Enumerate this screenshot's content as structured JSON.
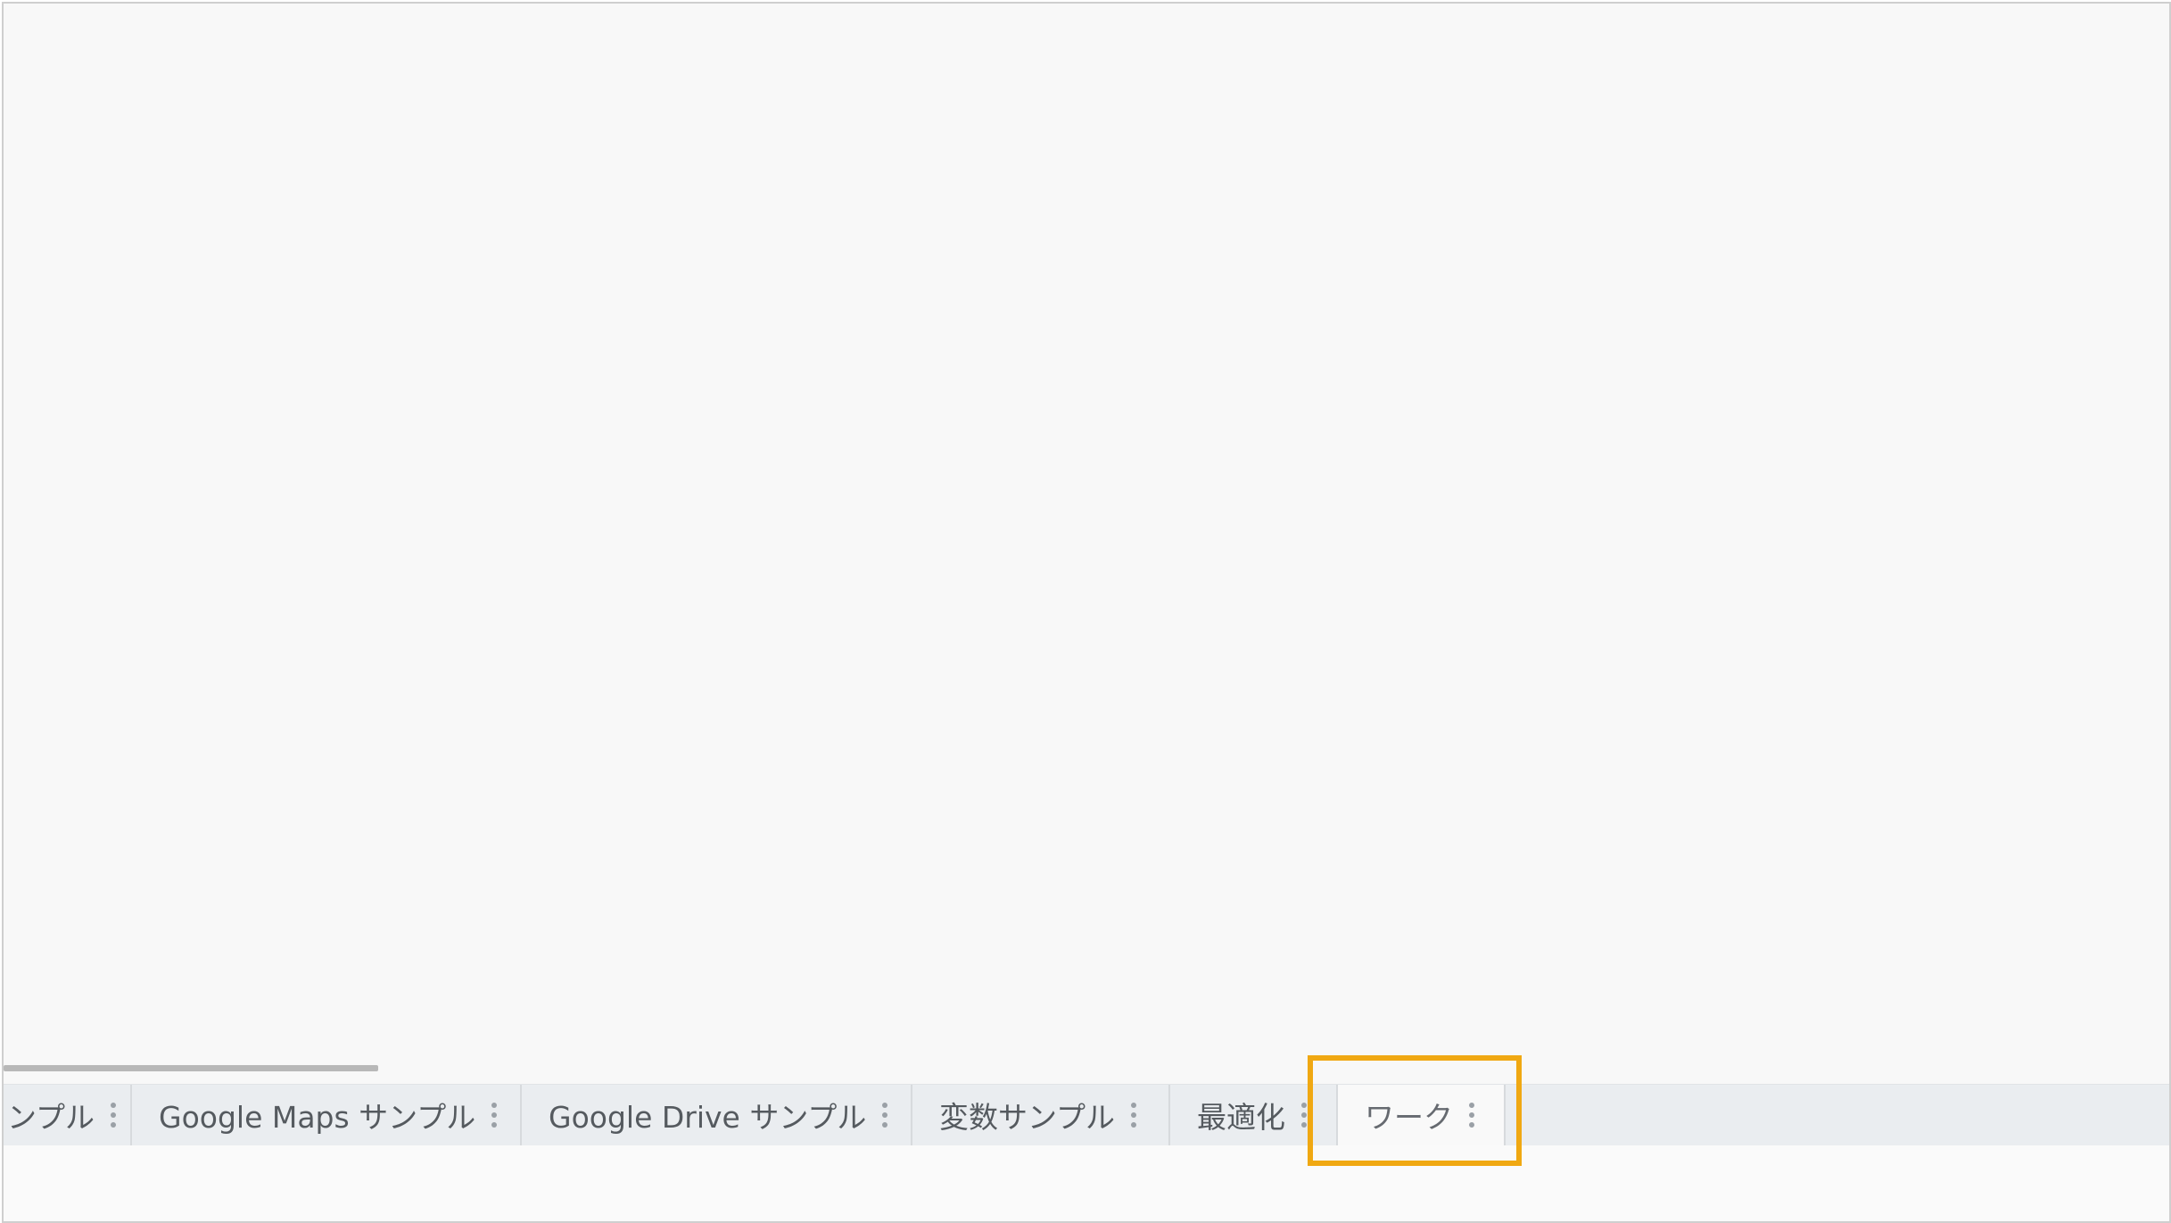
{
  "tabs": [
    {
      "label": "ンプル",
      "menu_icon": "more-vert-icon"
    },
    {
      "label": "Google Maps サンプル",
      "menu_icon": "more-vert-icon"
    },
    {
      "label": "Google Drive サンプル",
      "menu_icon": "more-vert-icon"
    },
    {
      "label": "変数サンプル",
      "menu_icon": "more-vert-icon"
    },
    {
      "label": "最適化",
      "menu_icon": "more-vert-icon"
    },
    {
      "label": "ワーク",
      "menu_icon": "more-vert-icon",
      "active": true
    }
  ],
  "highlight_color": "#f0a812"
}
